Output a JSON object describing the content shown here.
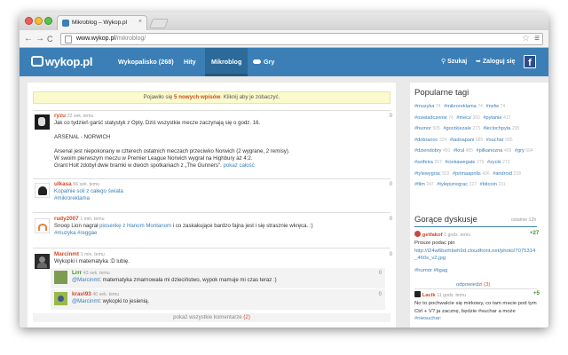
{
  "browser": {
    "tab_title": "Mikroblog – Wykop.pl",
    "tab_close": "×",
    "url_host": "www.wykop.pl",
    "url_path": "/mikroblog/",
    "back": "←",
    "forward": "→",
    "reload": "C",
    "star": "☆",
    "menu": "≡"
  },
  "header": {
    "logo": "wykop.pl",
    "nav": [
      "Wykopalisko (268)",
      "Hity",
      "Mikroblog",
      "Gry"
    ],
    "active_nav": "Mikroblog",
    "search": "Szukaj",
    "login": "Zaloguj się",
    "facebook": "f"
  },
  "banner": {
    "before": "Pojawiło się ",
    "highlight": "5 nowych wpisów",
    "after": ". Kliknij aby je zobaczyć."
  },
  "posts": [
    {
      "author": "ryzu",
      "author_color": "#d04a24",
      "meta": "22 sek. temu",
      "votes": "0",
      "lines": [
        "Jak co tydzień garść statystyk z Opty. Dziś wszystkie mecze zaczynają się o godz. 16.",
        "",
        "ARSENAL - NORWICH",
        "",
        "Arsenal jest niepokonany w czterech ostatnich meczach przeciwko Norwich (2 wygrane, 2 remisy).",
        "W swoim pierwszym meczu w Premier League Norwich wygrał na Highbury aż 4:2.",
        "Grant Holt zdobył dwie bramki w dwóch spotkaniach z „The Gunners\"."
      ],
      "more": "pokaż całość"
    },
    {
      "author": "ulkasa",
      "author_color": "#d04a24",
      "meta": "56 sek. temu",
      "votes": "0",
      "line1": "Kopalnie soli z całego świata",
      "tag": "#mikroreklama"
    },
    {
      "author": "rudy2007",
      "author_color": "#d04a24",
      "meta": "1 min. temu",
      "votes": "0",
      "before": "Snoop Lion nagrał ",
      "link": "piosenkę z Hanom Montanom",
      "after": " i co zaskakujące bardzo fajna jest i się strasznie wkręca. :)",
      "tags": "#muzyka #reggae"
    },
    {
      "author": "Marcinmt",
      "author_color": "#d04a24",
      "meta": "1 min. temu",
      "votes": "0",
      "line1": "Wykopki i matematyka :D lubię.",
      "replies": [
        {
          "author": "Lrrr",
          "author_color": "#3a8e1f",
          "meta": "43 sek. temu",
          "votes": "0",
          "mention": "@Marcinmt",
          "text": ": matematyka zmarnowała mi dzieciństwo, wypok mamuje mi czas teraz :)"
        },
        {
          "author": "kravi93",
          "author_color": "#d04a24",
          "meta": "40 sek. temu",
          "votes": "0",
          "mention": "@Marcinmt",
          "text": ": wykopki to jesienią."
        }
      ],
      "show_all_label": "pokaż wszystkie komentarze",
      "show_all_count": "(2)"
    }
  ],
  "sidebar": {
    "popular_title": "Popularne tagi",
    "tags": [
      [
        "#muzyka",
        "74"
      ],
      [
        "#mikroreklama",
        "74"
      ],
      [
        "#nsfw",
        "74"
      ],
      [
        "#oswiadczenie",
        "74"
      ],
      [
        "#mecz",
        "350"
      ],
      [
        "#pytanie",
        "417"
      ],
      [
        "#humor",
        "505"
      ],
      [
        "#gorzkiezale",
        "273"
      ],
      [
        "#leclochpyta",
        "295"
      ],
      [
        "#dobranoc",
        "324"
      ],
      [
        "#iadnapani",
        "685"
      ],
      [
        "#suchar",
        "685"
      ],
      [
        "#dziendobry",
        "481"
      ],
      [
        "#krul",
        "485"
      ],
      [
        "#pilkanozna",
        "409"
      ],
      [
        "#gry",
        "604"
      ],
      [
        "#szifeira",
        "267"
      ],
      [
        "#ciekawegate",
        "279"
      ],
      [
        "#zycki",
        "273"
      ],
      [
        "#tylewygrac",
        "503"
      ],
      [
        "#primaaprilis",
        "406"
      ],
      [
        "#android",
        "218"
      ],
      [
        "#film",
        "247"
      ],
      [
        "#tylepizregrac",
        "227"
      ],
      [
        "#bitcoin",
        "231"
      ]
    ],
    "hot_title": "Gorące dyskusje",
    "hot_time": "ostatnie 12h",
    "hot": [
      {
        "author": "getfakof",
        "meta": "1 godz. temu",
        "score": "+27",
        "lines": [
          "Prosze podac pin",
          "http://i24w6bsrhbeh9d.cloudfront.net/photo/7075314",
          "_460s_v2.jpg"
        ],
        "tags": "#humor #ligag",
        "replies_label": "odpowiedzi",
        "replies_count": "(3)"
      },
      {
        "author": "Lacik",
        "meta": "11 godz. temu",
        "score": "+5",
        "lines": [
          "No to pochwalcie się mirkowy, co tam macie pod tym",
          "Ctrl + V? ja zacznę, będzie #suchar a może",
          "#niesuchar:"
        ]
      }
    ]
  },
  "colors": {
    "brand_blue": "#3b7fb6",
    "accent_orange": "#d04a24",
    "score_green": "#3a8e1f",
    "banner_yellow": "#fafacd"
  }
}
